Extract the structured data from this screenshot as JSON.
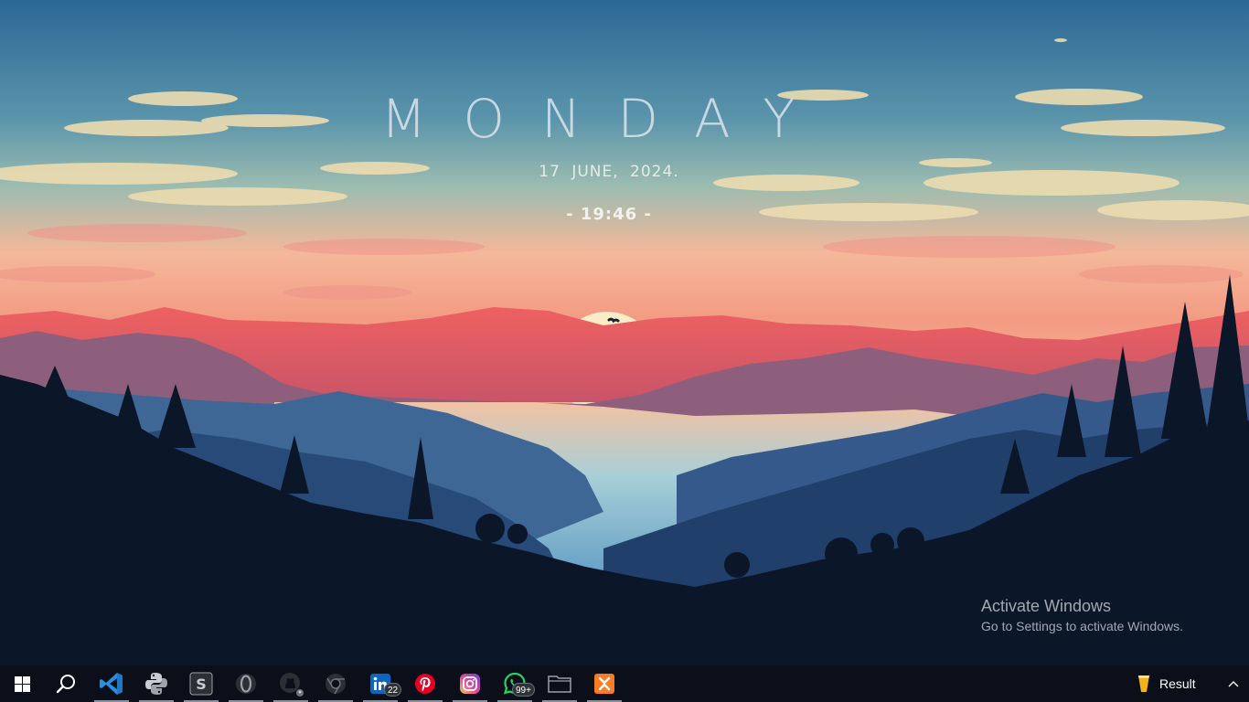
{
  "desktop": {
    "weekday": "MONDAY",
    "date": "17 JUNE, 2024.",
    "time": "- 19:46 -",
    "watermark": {
      "title": "Activate Windows",
      "subtitle": "Go to Settings to activate Windows."
    }
  },
  "taskbar": {
    "items": [
      {
        "name": "start",
        "icon": "windows-logo-icon"
      },
      {
        "name": "search",
        "icon": "search-icon"
      },
      {
        "name": "vscode",
        "icon": "vscode-icon",
        "running": true
      },
      {
        "name": "python",
        "icon": "python-icon",
        "running": true
      },
      {
        "name": "sublime",
        "icon": "sublime-text-icon",
        "running": true
      },
      {
        "name": "opera",
        "icon": "opera-icon",
        "running": true
      },
      {
        "name": "github",
        "icon": "github-icon",
        "running": true
      },
      {
        "name": "chrome",
        "icon": "chrome-icon",
        "running": true
      },
      {
        "name": "linkedin",
        "icon": "linkedin-icon",
        "badge": "22",
        "running": true
      },
      {
        "name": "pinterest",
        "icon": "pinterest-icon",
        "running": true
      },
      {
        "name": "instagram",
        "icon": "instagram-icon",
        "running": true
      },
      {
        "name": "whatsapp",
        "icon": "whatsapp-icon",
        "badge": "99+",
        "running": true
      },
      {
        "name": "file-explorer",
        "icon": "folder-icon",
        "running": true
      },
      {
        "name": "xampp",
        "icon": "xampp-icon",
        "running": true
      }
    ],
    "tray_app": {
      "label": "Result",
      "icon": "beer-glass-icon"
    },
    "tray_chevron": {
      "icon": "chevron-up-icon"
    }
  },
  "colors": {
    "taskbar_bg": "#0a0f19",
    "sky_top": "#2e6f9c",
    "sunset_pink": "#f08a7a",
    "sun": "#f7ecc4",
    "mountain_red": "#e2575a",
    "foreground_dark": "#0b1628",
    "vscode_blue": "#2a8fe0",
    "linkedin_blue": "#0a66c2",
    "pinterest_red": "#e60023",
    "whatsapp_green": "#25d366",
    "xampp_orange": "#fb7a24"
  }
}
